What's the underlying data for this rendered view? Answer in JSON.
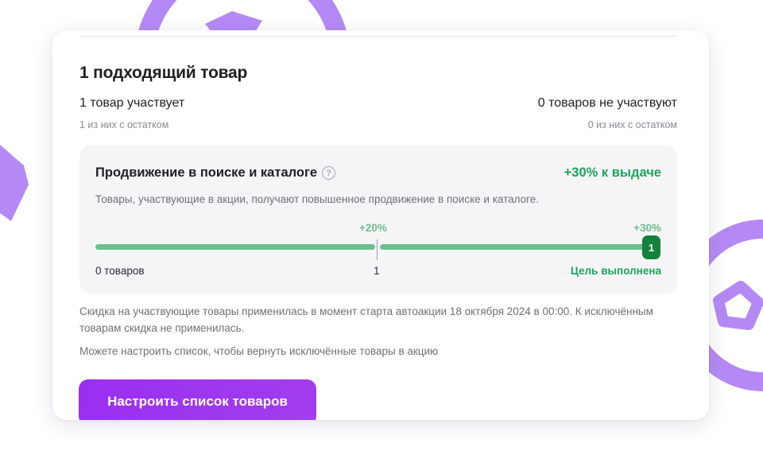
{
  "colors": {
    "accent": "#9a2ff0",
    "success": "#1ea35a",
    "progress": "#6cc08d",
    "badge": "#14823b",
    "decoration": "#b489f5"
  },
  "card": {
    "title": "1 подходящий товар",
    "participating": {
      "label": "1 товар участвует",
      "sub": "1 из них с остатком"
    },
    "not_participating": {
      "label": "0 товаров не участвуют",
      "sub": "0 из них с остатком"
    },
    "promotion": {
      "title": "Продвижение в поиске и каталоге",
      "help_icon": "question-circle-icon",
      "bonus": "+30% к выдаче",
      "description": "Товары, участвующие в акции, получают повышенное продвижение в поиске и каталоге.",
      "milestones": [
        "+20%",
        "+30%"
      ],
      "progress_fraction": 1.0,
      "current_count_badge": "1",
      "scale_start": "0 товаров",
      "scale_mid": "1",
      "goal_status": "Цель выполнена"
    },
    "note": "Скидка на участвующие товары применилась в момент старта автоакции 18 октября 2024 в 00:00. К исключённым товарам скидка не применилась.",
    "hint": "Можете настроить список, чтобы вернуть исключённые товары в акцию",
    "button_label": "Настроить список товаров"
  }
}
